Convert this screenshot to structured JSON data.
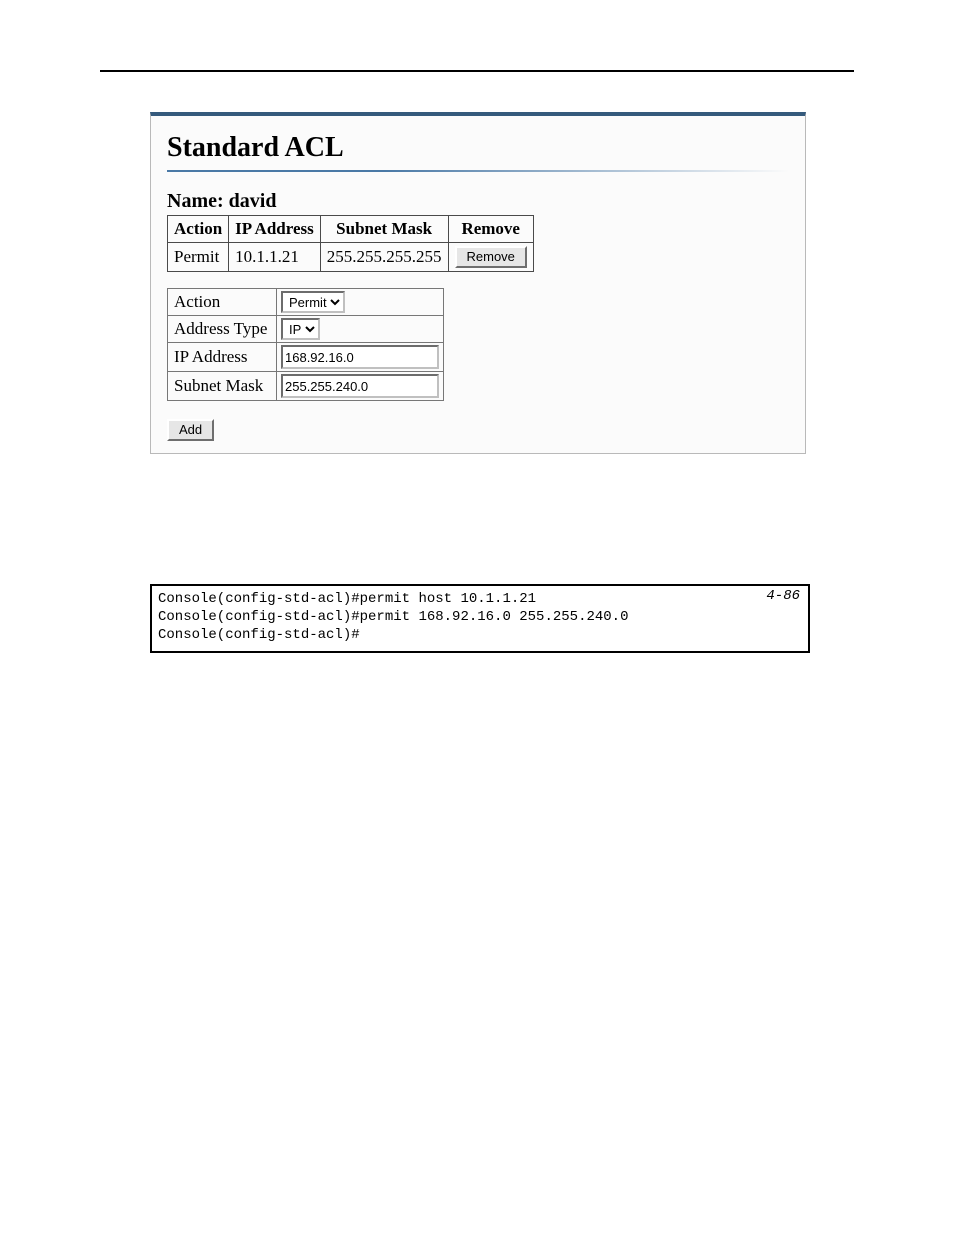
{
  "panel": {
    "title": "Standard ACL",
    "name_label_prefix": "Name: ",
    "name_value": "david",
    "table": {
      "headers": {
        "action": "Action",
        "ip": "IP Address",
        "mask": "Subnet Mask",
        "remove": "Remove"
      },
      "rows": [
        {
          "action": "Permit",
          "ip": "10.1.1.21",
          "mask": "255.255.255.255",
          "remove_label": "Remove"
        }
      ]
    },
    "form": {
      "action_label": "Action",
      "action_value": "Permit",
      "address_type_label": "Address Type",
      "address_type_value": "IP",
      "ip_label": "IP Address",
      "ip_value": "168.92.16.0",
      "mask_label": "Subnet Mask",
      "mask_value": "255.255.240.0",
      "add_button_label": "Add"
    }
  },
  "cli": {
    "page_ref": "4-86",
    "lines": [
      "Console(config-std-acl)#permit host 10.1.1.21",
      "Console(config-std-acl)#permit 168.92.16.0 255.255.240.0",
      "Console(config-std-acl)#"
    ]
  }
}
